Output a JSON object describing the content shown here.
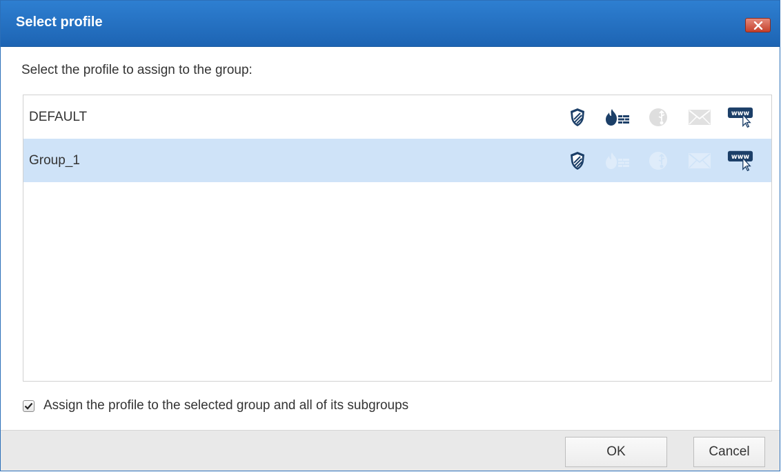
{
  "dialog": {
    "title": "Select profile",
    "close_icon": "close-x-icon",
    "prompt": "Select the profile to assign to the group:"
  },
  "profiles": [
    {
      "name": "DEFAULT",
      "selected": false,
      "features": [
        {
          "icon": "antivirus-shield-icon",
          "enabled": true
        },
        {
          "icon": "firewall-icon",
          "enabled": true
        },
        {
          "icon": "device-control-usb-icon",
          "enabled": false
        },
        {
          "icon": "mail-icon",
          "enabled": false
        },
        {
          "icon": "web-www-icon",
          "enabled": true
        }
      ]
    },
    {
      "name": "Group_1",
      "selected": true,
      "features": [
        {
          "icon": "antivirus-shield-icon",
          "enabled": true
        },
        {
          "icon": "firewall-icon",
          "enabled": false
        },
        {
          "icon": "device-control-usb-icon",
          "enabled": false
        },
        {
          "icon": "mail-icon",
          "enabled": false
        },
        {
          "icon": "web-www-icon",
          "enabled": true
        }
      ]
    }
  ],
  "subgroups_option": {
    "checked": true,
    "label": "Assign the profile to the selected group and all of its subgroups"
  },
  "buttons": {
    "ok": "OK",
    "cancel": "Cancel"
  },
  "colors": {
    "titlebar": "#1d64b3",
    "selected_row": "#cfe3f8",
    "icon_dark": "#1c3f68",
    "footer": "#e9e9e9"
  }
}
